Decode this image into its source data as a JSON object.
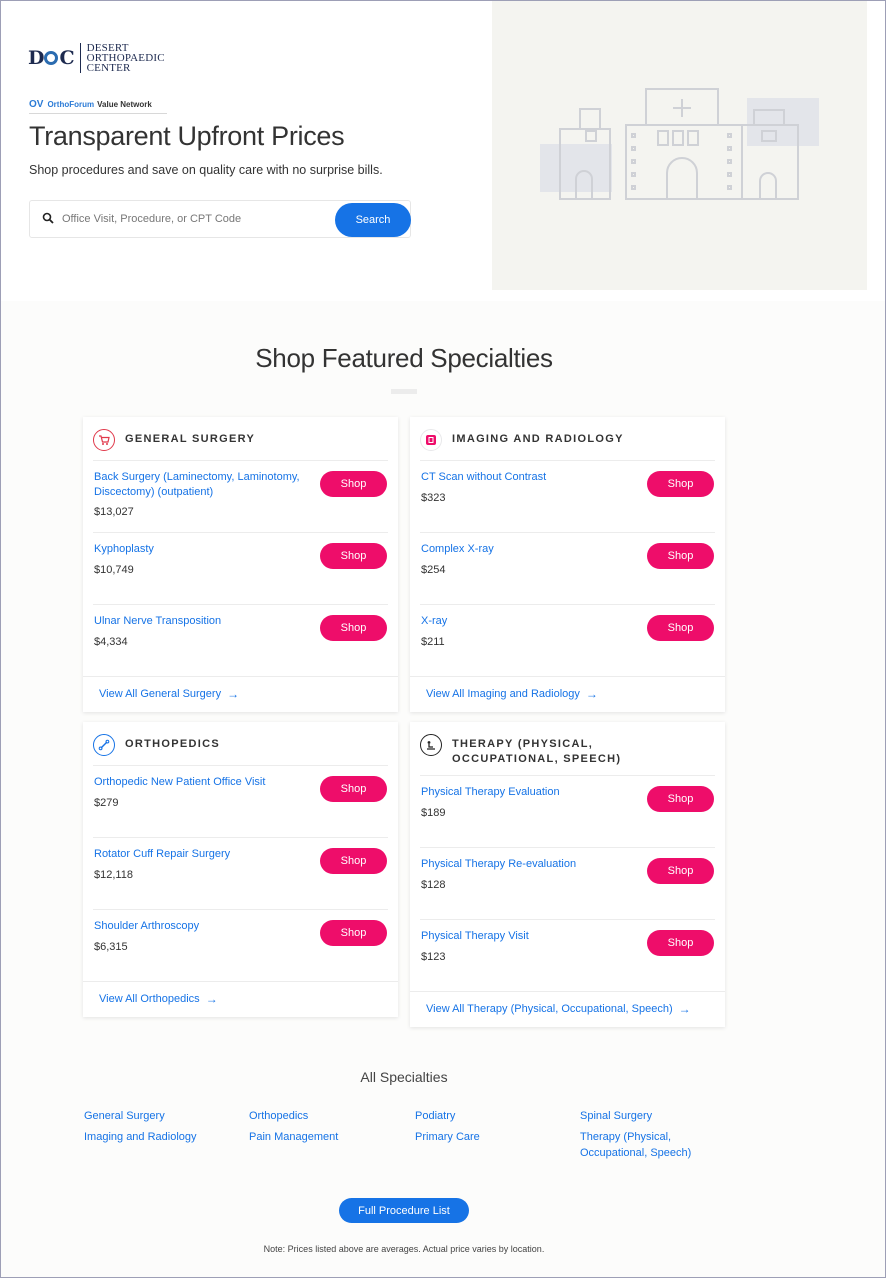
{
  "brand": {
    "logo_mark": "D",
    "logo_mark_end": "C",
    "logo_lines": [
      "Desert",
      "Orthopaedic",
      "Center"
    ],
    "network_ov": "OV",
    "network_orthoforum": "OrthoForum",
    "network_label": "Value Network"
  },
  "hero": {
    "title": "Transparent Upfront Prices",
    "subtitle": "Shop procedures and save on quality care with no surprise bills.",
    "search_placeholder": "Office Visit, Procedure, or CPT Code",
    "search_button": "Search"
  },
  "featured": {
    "title": "Shop Featured Specialties",
    "shop_label": "Shop",
    "cards": [
      {
        "title": "GENERAL SURGERY",
        "icon": "cart-icon",
        "items": [
          {
            "name": "Back Surgery (Laminectomy, Laminotomy, Discectomy) (outpatient)",
            "price": "$13,027"
          },
          {
            "name": "Kyphoplasty",
            "price": "$10,749"
          },
          {
            "name": "Ulnar Nerve Transposition",
            "price": "$4,334"
          }
        ],
        "view_all": "View All General Surgery"
      },
      {
        "title": "IMAGING AND RADIOLOGY",
        "icon": "xray-icon",
        "items": [
          {
            "name": "CT Scan without Contrast",
            "price": "$323"
          },
          {
            "name": "Complex X-ray",
            "price": "$254"
          },
          {
            "name": "X-ray",
            "price": "$211"
          }
        ],
        "view_all": "View All Imaging and Radiology"
      },
      {
        "title": "ORTHOPEDICS",
        "icon": "bone-icon",
        "items": [
          {
            "name": "Orthopedic New Patient Office Visit",
            "price": "$279"
          },
          {
            "name": "Rotator Cuff Repair Surgery",
            "price": "$12,118"
          },
          {
            "name": "Shoulder Arthroscopy",
            "price": "$6,315"
          }
        ],
        "view_all": "View All Orthopedics"
      },
      {
        "title": "THERAPY (PHYSICAL, OCCUPATIONAL, SPEECH)",
        "icon": "therapy-icon",
        "items": [
          {
            "name": "Physical Therapy Evaluation",
            "price": "$189"
          },
          {
            "name": "Physical Therapy Re-evaluation",
            "price": "$128"
          },
          {
            "name": "Physical Therapy Visit",
            "price": "$123"
          }
        ],
        "view_all": "View All Therapy (Physical, Occupational, Speech)"
      }
    ]
  },
  "all_specialties": {
    "title": "All Specialties",
    "links": [
      "General Surgery",
      "Imaging and Radiology",
      "Orthopedics",
      "Pain Management",
      "Podiatry",
      "Primary Care",
      "Spinal Surgery",
      "Therapy (Physical, Occupational, Speech)"
    ]
  },
  "full_list_button": "Full Procedure List",
  "note": "Note: Prices listed above are averages. Actual price varies by location.",
  "colors": {
    "primary_blue": "#1673e6",
    "shop_pink": "#ee0d6a",
    "text_dark": "#333333"
  }
}
